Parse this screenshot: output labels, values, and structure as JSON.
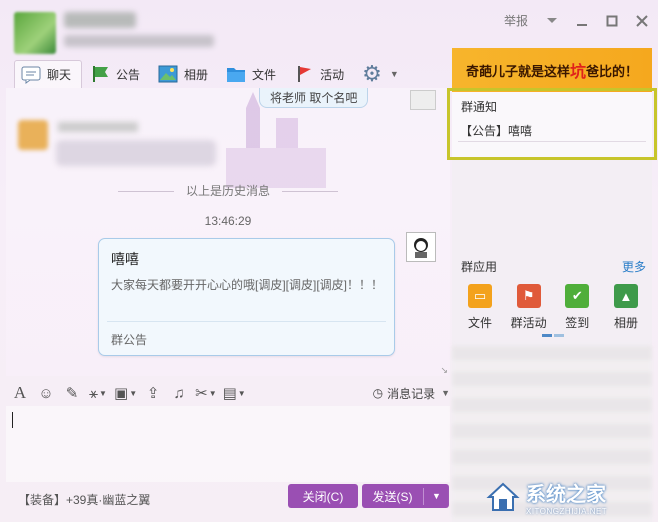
{
  "window": {
    "report": "举报",
    "menu_icon": "chevron-down-icon",
    "minimize_icon": "minimize-icon",
    "maximize_icon": "maximize-icon",
    "close_icon": "close-icon"
  },
  "tabs": [
    {
      "label": "聊天",
      "icon": "chat-icon"
    },
    {
      "label": "公告",
      "icon": "announcement-flag-icon"
    },
    {
      "label": "相册",
      "icon": "photo-album-icon"
    },
    {
      "label": "文件",
      "icon": "folder-icon"
    },
    {
      "label": "活动",
      "icon": "event-flag-icon"
    }
  ],
  "chat": {
    "old_message": "将老师   取个名吧",
    "history_divider": "以上是历史消息",
    "timestamp": "13:46:29",
    "notice": {
      "title": "嘻嘻",
      "body": "大家每天都要开开心心的哦[调皮][调皮][调皮]！！！",
      "footer": "群公告"
    }
  },
  "input_toolbar": {
    "tools": [
      "font-icon",
      "emoji-icon",
      "magic-icon",
      "shake-icon",
      "image-icon",
      "upload-icon",
      "music-icon",
      "screenshot-icon",
      "doodle-icon"
    ],
    "history_label": "消息记录"
  },
  "bottom": {
    "badge": "【装备】+39真·幽蓝之翼",
    "close_label": "关闭(C)",
    "send_label": "发送(S)"
  },
  "right_panel": {
    "ad": {
      "prefix": "奇葩儿子就是这样",
      "highlight": "坑",
      "suffix": "爸比的！"
    },
    "notice_title": "群通知",
    "notice_item": "【公告】嘻嘻",
    "apps_title": "群应用",
    "apps_more": "更多",
    "apps": [
      {
        "label": "文件",
        "icon": "folder-app-icon",
        "color": "#f3a21c"
      },
      {
        "label": "群活动",
        "icon": "group-activity-icon",
        "color": "#e05a3a"
      },
      {
        "label": "签到",
        "icon": "checkin-icon",
        "color": "#4fae3a"
      },
      {
        "label": "相册",
        "icon": "album-app-icon",
        "color": "#3e9a4a"
      }
    ]
  },
  "watermark": {
    "cn": "系统之家",
    "en": "XITONGZHIJIA.NET"
  }
}
